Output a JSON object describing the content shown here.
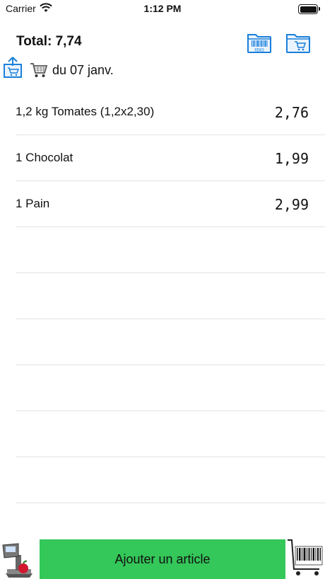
{
  "status_bar": {
    "carrier": "Carrier",
    "time": "1:12 PM"
  },
  "header": {
    "total_label": "Total: 7,74",
    "list_title": "du 07 janv.",
    "barcode_folder_digits": "6583"
  },
  "items": [
    {
      "name": "1,2 kg Tomates (1,2x2,30)",
      "price": "2,76"
    },
    {
      "name": "1 Chocolat",
      "price": "1,99"
    },
    {
      "name": "1 Pain",
      "price": "2,99"
    },
    {
      "name": "",
      "price": ""
    },
    {
      "name": "",
      "price": ""
    },
    {
      "name": "",
      "price": ""
    },
    {
      "name": "",
      "price": ""
    },
    {
      "name": "",
      "price": ""
    },
    {
      "name": "",
      "price": ""
    }
  ],
  "footer": {
    "add_button_label": "Ajouter un article"
  },
  "colors": {
    "accent_blue": "#1a7fd9",
    "add_button_green": "#34c759"
  }
}
